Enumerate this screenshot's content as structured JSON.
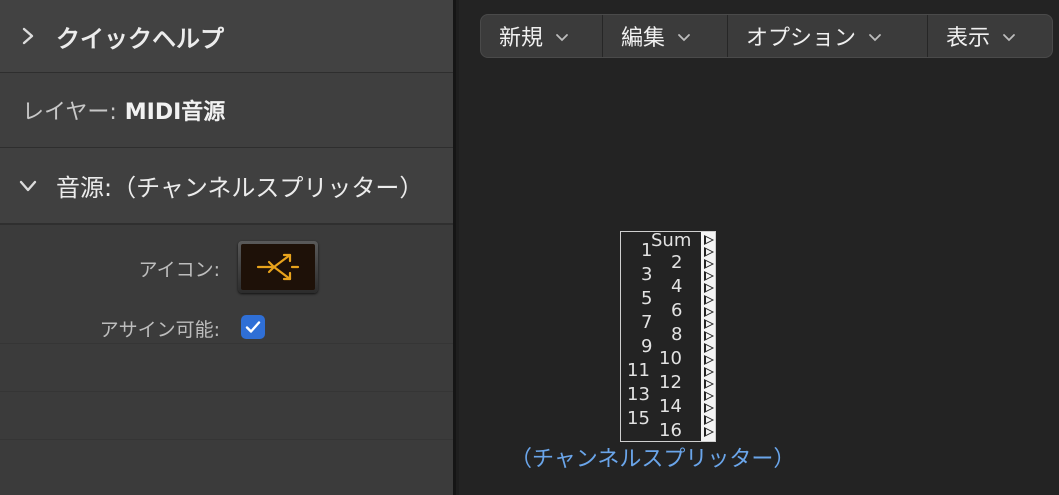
{
  "inspector": {
    "quick_help": {
      "label": "クイックヘルプ",
      "expanded": false
    },
    "layer": {
      "label": "レイヤー:",
      "value": "MIDI音源"
    },
    "source": {
      "label": "音源:（チャンネルスプリッター）",
      "expanded": true
    },
    "properties": {
      "icon_label": "アイコン:",
      "icon": "channel-splitter-icon",
      "assignable_label": "アサイン可能:",
      "assignable_checked": true
    }
  },
  "toolbar": {
    "menus": [
      {
        "label": "新規"
      },
      {
        "label": "編集"
      },
      {
        "label": "オプション"
      },
      {
        "label": "表示"
      }
    ]
  },
  "environment_object": {
    "name": "（チャンネルスプリッター）",
    "sum_label": "Sum",
    "odd_ports": [
      "1",
      "3",
      "5",
      "7",
      "9",
      "11",
      "13",
      "15"
    ],
    "even_ports": [
      "2",
      "4",
      "6",
      "8",
      "10",
      "12",
      "14",
      "16"
    ],
    "output_count": 17
  },
  "colors": {
    "accent_blue": "#2f6fd6",
    "object_name": "#6aa5ea",
    "icon_orange": "#e8a31c"
  }
}
